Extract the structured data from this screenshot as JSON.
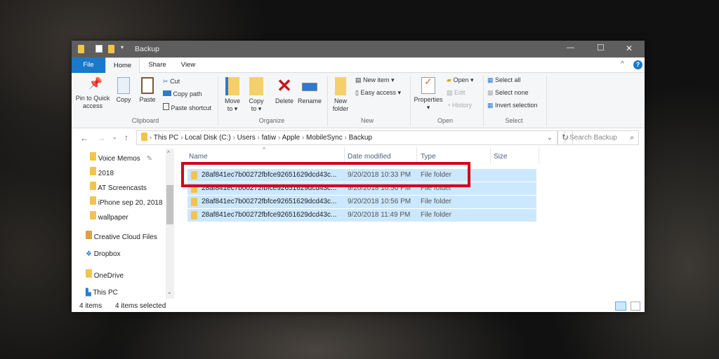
{
  "window": {
    "title": "Backup",
    "minimize": "—",
    "maximize": "☐",
    "close": "✕"
  },
  "tabs": [
    {
      "label": "File"
    },
    {
      "label": "Home"
    },
    {
      "label": "Share"
    },
    {
      "label": "View"
    }
  ],
  "ribbon": {
    "clipboard": {
      "pin": "Pin to Quick access",
      "copy": "Copy",
      "paste": "Paste",
      "cut": "Cut",
      "copy_path": "Copy path",
      "paste_shortcut": "Paste shortcut",
      "group": "Clipboard"
    },
    "organize": {
      "move_to": "Move to ▾",
      "copy_to": "Copy to ▾",
      "delete": "Delete",
      "rename": "Rename",
      "group": "Organize"
    },
    "new": {
      "new_folder": "New folder",
      "new_item": "New item ▾",
      "easy_access": "Easy access ▾",
      "group": "New"
    },
    "open": {
      "properties": "Properties",
      "open": "Open ▾",
      "edit": "Edit",
      "history": "History",
      "group": "Open"
    },
    "select": {
      "select_all": "Select all",
      "select_none": "Select none",
      "invert": "Invert selection",
      "group": "Select"
    }
  },
  "address": {
    "path": [
      "This PC",
      "Local Disk (C:)",
      "Users",
      "fatiw",
      "Apple",
      "MobileSync",
      "Backup"
    ],
    "search_placeholder": "Search Backup"
  },
  "nav": [
    {
      "label": "Voice Memos"
    },
    {
      "label": "2018"
    },
    {
      "label": "AT Screencasts"
    },
    {
      "label": "iPhone sep 20, 2018"
    },
    {
      "label": "wallpaper"
    },
    {
      "label": "Creative Cloud Files"
    },
    {
      "label": "Dropbox"
    },
    {
      "label": "OneDrive"
    },
    {
      "label": "This PC"
    }
  ],
  "columns": {
    "name": "Name",
    "date": "Date modified",
    "type": "Type",
    "size": "Size"
  },
  "files": [
    {
      "name": "28af841ec7b00272fbfce92651629dcd43c...",
      "date": "9/20/2018 10:33 PM",
      "type": "File folder"
    },
    {
      "name": "28af841ec7b00272fbfce92651629dcd43c...",
      "date": "9/20/2018 10:50 PM",
      "type": "File folder"
    },
    {
      "name": "28af841ec7b00272fbfce92651629dcd43c...",
      "date": "9/20/2018 10:56 PM",
      "type": "File folder"
    },
    {
      "name": "28af841ec7b00272fbfce92651629dcd43c...",
      "date": "9/20/2018 11:49 PM",
      "type": "File folder"
    }
  ],
  "status": {
    "items": "4 items",
    "selected": "4 items selected"
  },
  "colors": {
    "accent": "#1979ca",
    "selection": "#cce8ff",
    "highlight": "#d0021b"
  }
}
